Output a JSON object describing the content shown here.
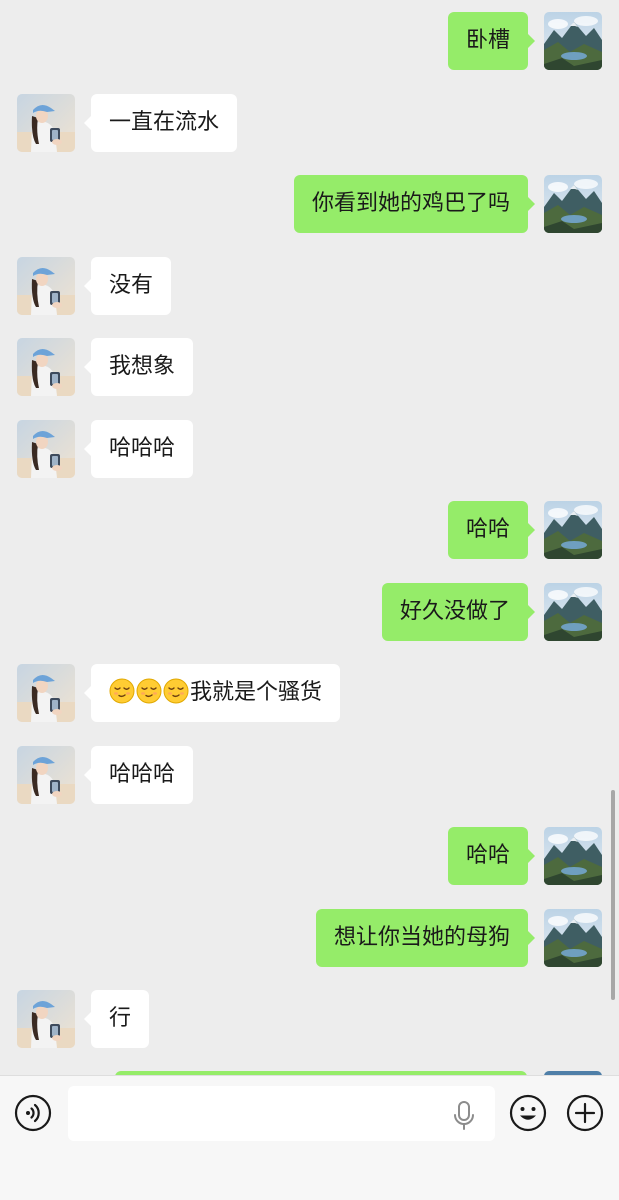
{
  "app": {
    "accent_color": "#95ec69",
    "background_color": "#ededed"
  },
  "messages": [
    {
      "sender": "me",
      "text": "卧槽"
    },
    {
      "sender": "contact",
      "text": "一直在流水"
    },
    {
      "sender": "me",
      "text": "你看到她的鸡巴了吗"
    },
    {
      "sender": "contact",
      "text": "没有"
    },
    {
      "sender": "contact",
      "text": "我想象"
    },
    {
      "sender": "contact",
      "text": "哈哈哈"
    },
    {
      "sender": "me",
      "text": "哈哈"
    },
    {
      "sender": "me",
      "text": "好久没做了"
    },
    {
      "sender": "contact",
      "emoji_prefix": [
        "smirk-emoji",
        "smirk-emoji",
        "smirk-emoji"
      ],
      "text": "我就是个骚货"
    },
    {
      "sender": "contact",
      "text": "哈哈哈"
    },
    {
      "sender": "me",
      "text": "哈哈"
    },
    {
      "sender": "me",
      "text": "想让你当她的母狗"
    },
    {
      "sender": "contact",
      "text": "行"
    }
  ],
  "input_bar": {
    "placeholder": "",
    "icons": [
      "voice-icon",
      "microphone-icon",
      "emoji-icon",
      "plus-icon"
    ]
  }
}
